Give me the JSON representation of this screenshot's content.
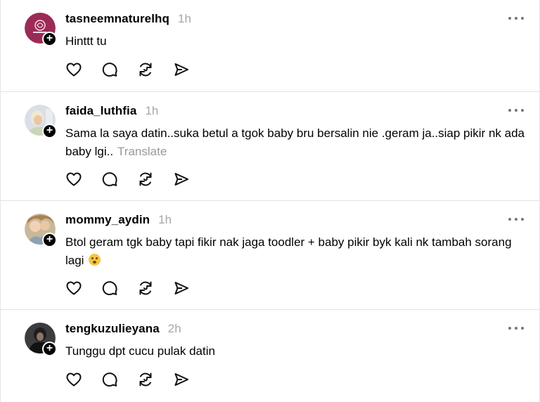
{
  "posts": [
    {
      "username": "tasneemnaturelhq",
      "time": "1h",
      "text": "Hinttt tu",
      "avatar": "brand-logo-avatar",
      "avatar_color": "#9c2a57"
    },
    {
      "username": "faida_luthfia",
      "time": "1h",
      "text": "Sama la saya datin..suka betul a tgok baby bru bersalin nie .geram ja..siap pikir nk ada baby lgi..",
      "translate": "Translate",
      "avatar": "user-photo-avatar"
    },
    {
      "username": "mommy_aydin",
      "time": "1h",
      "text": "Btol geram tgk baby tapi fikir nak jaga toodler + baby pikir byk kali nk tambah sorang lagi",
      "emoji": "flushed-face-emoji",
      "avatar": "user-photo-avatar"
    },
    {
      "username": "tengkuzulieyana",
      "time": "2h",
      "text": "Tunggu dpt cucu pulak datin",
      "avatar": "user-photo-avatar"
    }
  ],
  "follow_badge": "+",
  "action_icons": [
    "heart-icon",
    "comment-icon",
    "repost-icon",
    "share-icon"
  ]
}
